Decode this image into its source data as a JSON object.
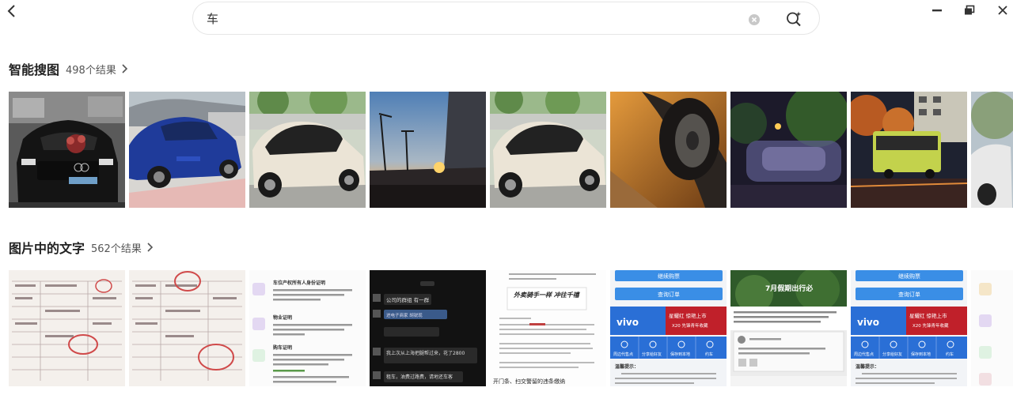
{
  "search": {
    "query": "车"
  },
  "sections": [
    {
      "title": "智能搜图",
      "count": "498个结果"
    },
    {
      "title": "图片中的文字",
      "count": "562个结果"
    }
  ],
  "icons": {
    "back": "chevron-left-icon",
    "clear": "clear-circle-icon",
    "image_search": "image-search-icon",
    "minimize": "minimize-icon",
    "restore": "restore-window-icon",
    "close": "close-icon"
  },
  "text_thumbs": {
    "t2_phone": [
      "公司的群组 有一群",
      "进电子商家 胡锐现",
      "我上次从上海把腿帮过来，花了2800",
      "租车，油费过路费，请地还车客"
    ],
    "t4_buttons": [
      "继续购票",
      "查询订单",
      "星耀红 惊艳上市",
      "X20 先锋青年收藏",
      "周边代售点",
      "分享给好友",
      "保存到本地",
      "约车",
      "温馨提示："
    ],
    "t5_banner": "7月假期出行必",
    "t3_quote": "外卖骑手一样 冲往千禧",
    "t3_footer": "开门条、扫交警留的违条缴纳",
    "t1_heads": [
      "车位产权所有人身份证明",
      "物业证明",
      "购车证明"
    ]
  },
  "colors": {
    "bus_green": "#c3d24c",
    "app_blue": "#3a8ee6",
    "vivo_blue": "#2a6fd6",
    "vivo_red": "#c0202a"
  }
}
